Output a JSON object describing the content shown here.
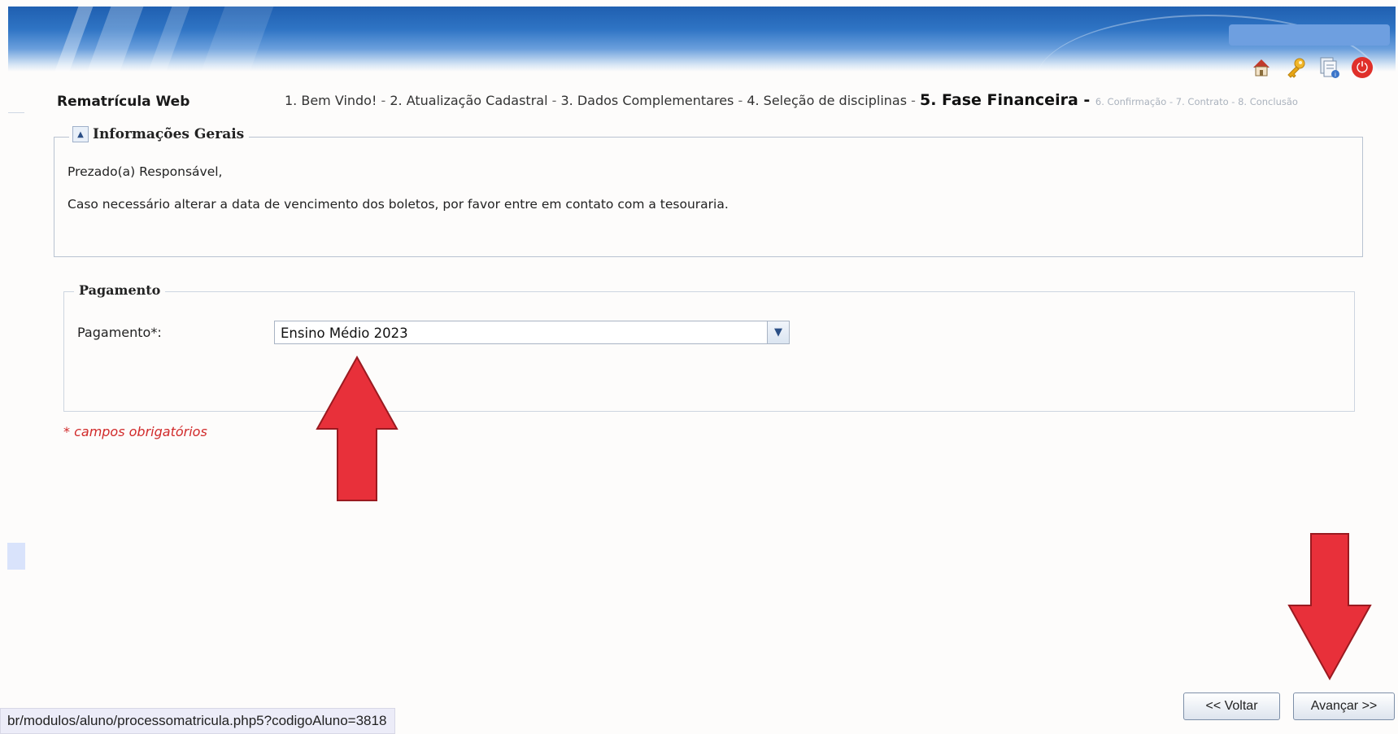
{
  "header": {
    "icons": [
      "home-icon",
      "key-icon",
      "document-icon",
      "power-icon"
    ]
  },
  "app": {
    "title": "Rematrícula Web"
  },
  "steps": [
    {
      "label": "1. Bem Vindo!",
      "state": "done"
    },
    {
      "label": "2. Atualização Cadastral",
      "state": "done"
    },
    {
      "label": "3. Dados Complementares",
      "state": "done"
    },
    {
      "label": "4. Seleção de disciplinas",
      "state": "done"
    },
    {
      "label": "5. Fase Financeira",
      "state": "current"
    },
    {
      "label": "6. Confirmação",
      "state": "future"
    },
    {
      "label": "7. Contrato",
      "state": "future"
    },
    {
      "label": "8. Conclusão",
      "state": "future"
    }
  ],
  "info": {
    "title": "Informações Gerais",
    "greeting": "Prezado(a) Responsável,",
    "message": "Caso necessário alterar a data de vencimento dos boletos, por favor entre em contato com a tesouraria."
  },
  "payment": {
    "title": "Pagamento",
    "label": "Pagamento*:",
    "selected": "Ensino Médio 2023"
  },
  "required_note": "* campos obrigatórios",
  "buttons": {
    "back": "<< Voltar",
    "next": "Avançar >>"
  },
  "status_url": "br/modulos/aluno/processomatricula.php5?codigoAluno=3818",
  "colors": {
    "annotation_arrow": "#e8303a",
    "required": "#d12a2a",
    "accent": "#2f74c4"
  }
}
